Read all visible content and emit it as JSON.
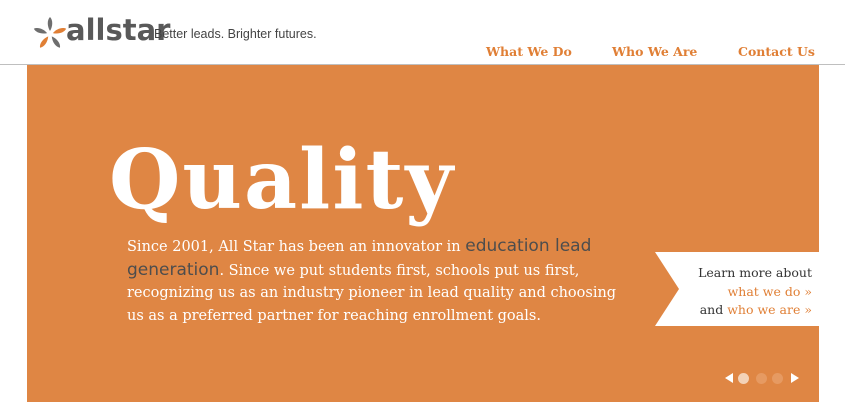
{
  "header": {
    "brand": "allstar",
    "tagline": "Better leads. Brighter futures.",
    "nav": [
      "What We Do",
      "Who We Are",
      "Contact Us"
    ]
  },
  "hero": {
    "title": "Quality",
    "body_intro": "Since 2001, All Star has been an innovator in",
    "body_highlight": "education lead generation",
    "body_rest": ". Since we put students first, schools put us first, recognizing us as an industry pioneer in lead quality and choosing us as a preferred partner for reaching enrollment goals."
  },
  "cta": {
    "line1": "Learn more about",
    "link1": "what we do »",
    "and": "and",
    "link2": "who we are »"
  },
  "slider": {
    "slide_count": 3,
    "active_index": 0
  },
  "colors": {
    "accent": "#df8644",
    "link": "#e07f35",
    "text_dark": "#4d4d4d"
  }
}
